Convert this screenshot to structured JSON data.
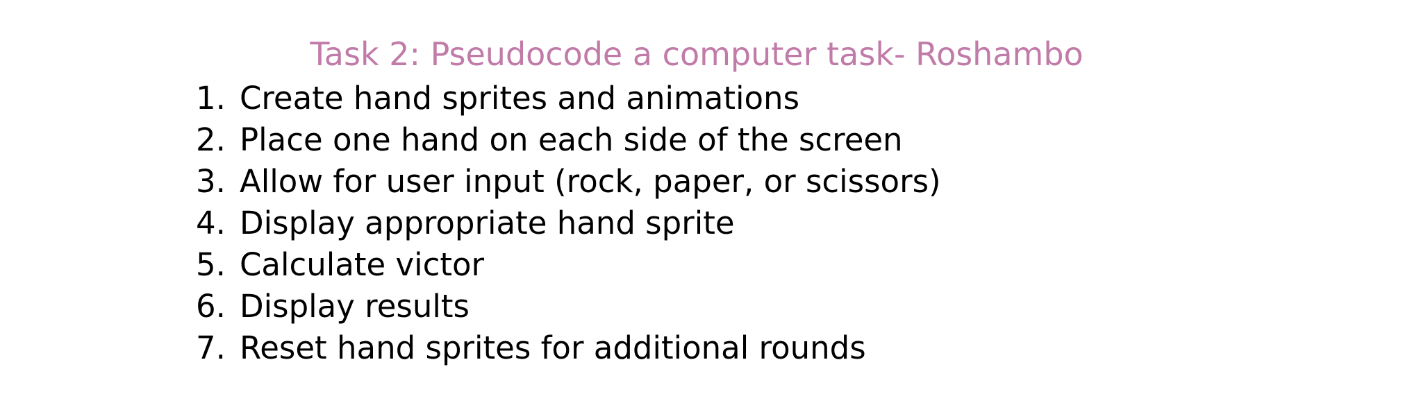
{
  "title": {
    "text": "Task 2: Pseudocode a computer task- Roshambo",
    "color": "#c17ba8"
  },
  "steps": [
    {
      "number": "1.",
      "text": "Create hand sprites and animations"
    },
    {
      "number": "2.",
      "text": "Place one hand on each side of the screen"
    },
    {
      "number": "3.",
      "text": "Allow for user input (rock, paper, or scissors)"
    },
    {
      "number": "4.",
      "text": "Display appropriate hand sprite"
    },
    {
      "number": "5.",
      "text": "Calculate victor"
    },
    {
      "number": "6.",
      "text": "Display results"
    },
    {
      "number": "7.",
      "text": "Reset hand sprites for additional rounds"
    }
  ]
}
